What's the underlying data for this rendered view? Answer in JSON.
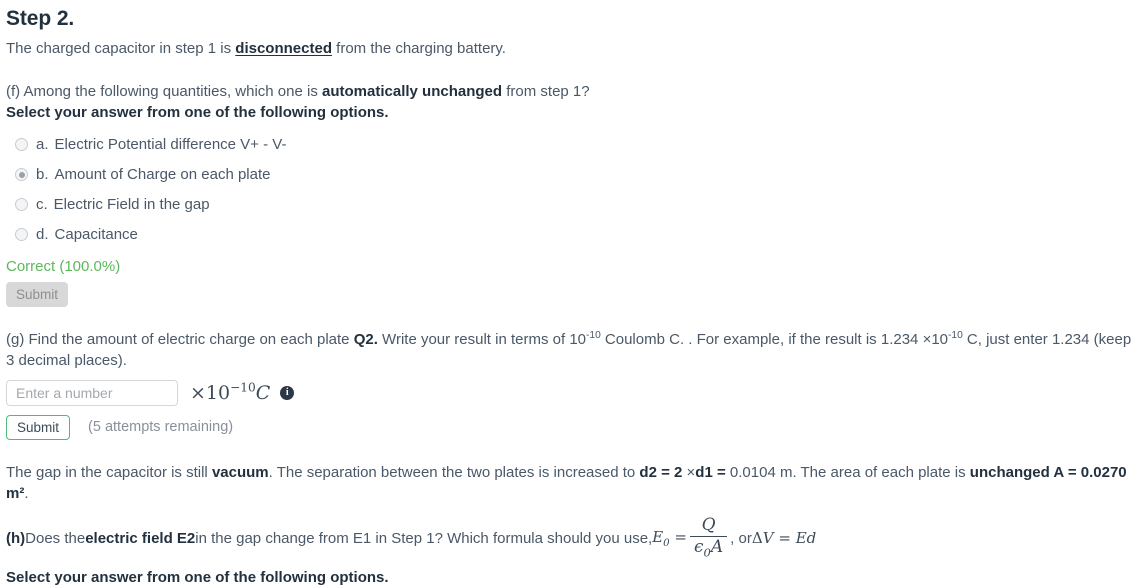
{
  "step": {
    "title": "Step 2.",
    "intro_before": "The charged capacitor in step 1 is ",
    "intro_bold_underline": "disconnected",
    "intro_after": " from the charging battery."
  },
  "question_f": {
    "prompt_before": "(f) Among the following quantities, which one is ",
    "prompt_bold": "automatically unchanged",
    "prompt_after": " from step 1?",
    "select_instruction": "Select your answer from one of the following options.",
    "options": [
      {
        "letter": "a.",
        "text": "Electric Potential difference V+ - V-",
        "selected": false
      },
      {
        "letter": "b.",
        "text": "Amount of Charge on each plate",
        "selected": true
      },
      {
        "letter": "c.",
        "text": "Electric Field in the gap",
        "selected": false
      },
      {
        "letter": "d.",
        "text": "Capacitance",
        "selected": false
      }
    ],
    "feedback": "Correct (100.0%)",
    "submit_label": "Submit"
  },
  "question_g": {
    "prompt_p1": "(g) Find the amount of electric charge on each plate ",
    "prompt_bold1": "Q2.",
    "prompt_p2": "  Write your result in terms of 10",
    "prompt_exp1": "-10",
    "prompt_p3": " Coulomb C. . For example, if the result is 1.234 ",
    "prompt_times": "×",
    "prompt_p4": "10",
    "prompt_exp2": "-10",
    "prompt_p5": " C, just enter 1.234 (keep 3 decimal places).",
    "input_value": "",
    "input_placeholder": "Enter a number",
    "unit_times": "×",
    "unit_base": "10",
    "unit_exponent": "−10",
    "unit_symbol": "C",
    "info_icon_label": "i",
    "submit_label": "Submit",
    "attempts_text": "(5 attempts remaining)"
  },
  "context": {
    "p1": "The gap in the capacitor is still ",
    "b1": "vacuum",
    "p2": ". The separation between the two plates is increased to ",
    "b2": "d2 = 2 ",
    "times": "×",
    "b3": "d1 =",
    "p3": " 0.0104 m. The area of each plate is ",
    "b4": "unchanged A = 0.0270 m²",
    "p4": "."
  },
  "question_h": {
    "label": "(h)",
    "p1": "  Does the ",
    "bold1": "electric field E2",
    "p2": " in the gap change from E1 in Step 1? Which formula should you use, ",
    "formula1_lhs": "E",
    "formula1_lhs_sub": "0",
    "formula1_eq": "=",
    "formula1_num": "Q",
    "formula1_den_eps": "ϵ",
    "formula1_den_sub": "0",
    "formula1_den_A": "A",
    "p3": ", or ",
    "formula2_delta": "Δ",
    "formula2_V": "V",
    "formula2_eq": "=",
    "formula2_rhs": "Ed",
    "select_instruction": "Select your answer from one of the following options."
  },
  "colors": {
    "text": "#3d4b59",
    "heading": "#23313f",
    "correct_green": "#5cb85c",
    "button_green_border": "#4cbb7c",
    "muted": "#8a9099"
  }
}
